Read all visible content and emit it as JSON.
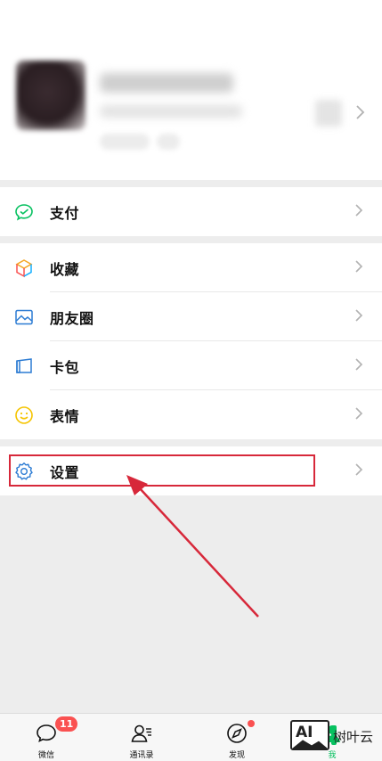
{
  "menu": {
    "pay": {
      "label": "支付",
      "icon": "wechat-pay-icon"
    },
    "favorites": {
      "label": "收藏",
      "icon": "cube-icon"
    },
    "moments": {
      "label": "朋友圈",
      "icon": "image-icon"
    },
    "cards": {
      "label": "卡包",
      "icon": "wallet-icon"
    },
    "stickers": {
      "label": "表情",
      "icon": "smiley-icon"
    },
    "settings": {
      "label": "设置",
      "icon": "gear-icon"
    }
  },
  "tabbar": {
    "chats": {
      "label": "微信",
      "badge": "11",
      "icon": "chat-bubble-icon"
    },
    "contacts": {
      "label": "通讯录",
      "icon": "contacts-icon"
    },
    "discover": {
      "label": "发现",
      "icon": "compass-icon",
      "has_dot": true
    },
    "me": {
      "label": "我",
      "icon": "person-icon"
    }
  },
  "watermark": {
    "ai_text": "AI",
    "brand_text": "树叶云"
  },
  "colors": {
    "accent_green": "#07c160",
    "badge_red": "#fa5151",
    "annotation_red": "#d7283a",
    "background": "#ededed"
  }
}
